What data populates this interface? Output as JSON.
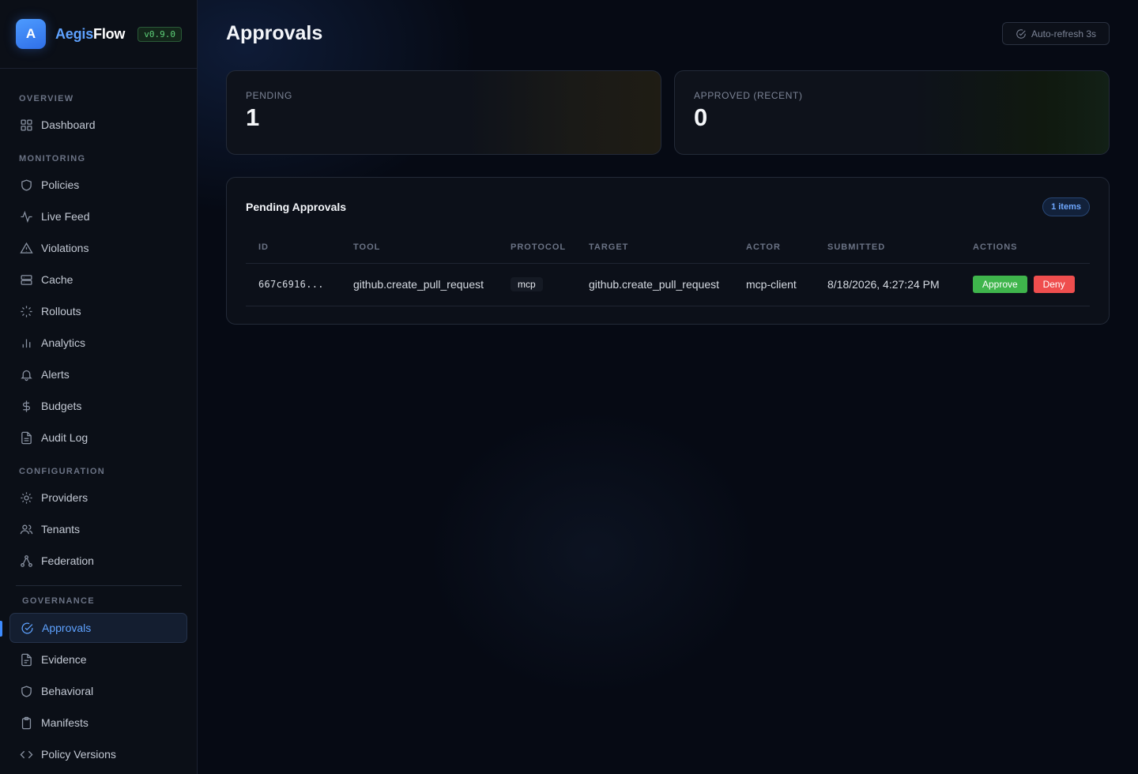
{
  "brand": {
    "logo_letter": "A",
    "name_part1": "Aegis",
    "name_part2": "Flow",
    "version": "v0.9.0"
  },
  "sidebar": {
    "sections": {
      "overview": "OVERVIEW",
      "monitoring": "MONITORING",
      "configuration": "CONFIGURATION",
      "governance": "GOVERNANCE"
    },
    "items": {
      "dashboard": "Dashboard",
      "policies": "Policies",
      "live_feed": "Live Feed",
      "violations": "Violations",
      "cache": "Cache",
      "rollouts": "Rollouts",
      "analytics": "Analytics",
      "alerts": "Alerts",
      "budgets": "Budgets",
      "audit_log": "Audit Log",
      "providers": "Providers",
      "tenants": "Tenants",
      "federation": "Federation",
      "approvals": "Approvals",
      "evidence": "Evidence",
      "behavioral": "Behavioral",
      "manifests": "Manifests",
      "policy_versions": "Policy Versions"
    },
    "active": "approvals"
  },
  "header": {
    "title": "Approvals",
    "auto_refresh": "Auto-refresh 3s"
  },
  "stats": {
    "pending": {
      "label": "PENDING",
      "value": "1"
    },
    "approved": {
      "label": "APPROVED (RECENT)",
      "value": "0"
    }
  },
  "panel": {
    "title": "Pending Approvals",
    "count_badge": "1 items",
    "columns": {
      "id": "ID",
      "tool": "TOOL",
      "protocol": "PROTOCOL",
      "target": "TARGET",
      "actor": "ACTOR",
      "submitted": "SUBMITTED",
      "actions": "ACTIONS"
    },
    "rows": [
      {
        "id": "667c6916...",
        "tool": "github.create_pull_request",
        "protocol": "mcp",
        "target": "github.create_pull_request",
        "actor": "mcp-client",
        "submitted": "8/18/2026, 4:27:24 PM",
        "approve_label": "Approve",
        "deny_label": "Deny"
      }
    ]
  },
  "colors": {
    "accent": "#5ea2ff",
    "approve": "#3fb54c",
    "deny": "#ef4e4e",
    "version_green": "#5fd27a"
  }
}
